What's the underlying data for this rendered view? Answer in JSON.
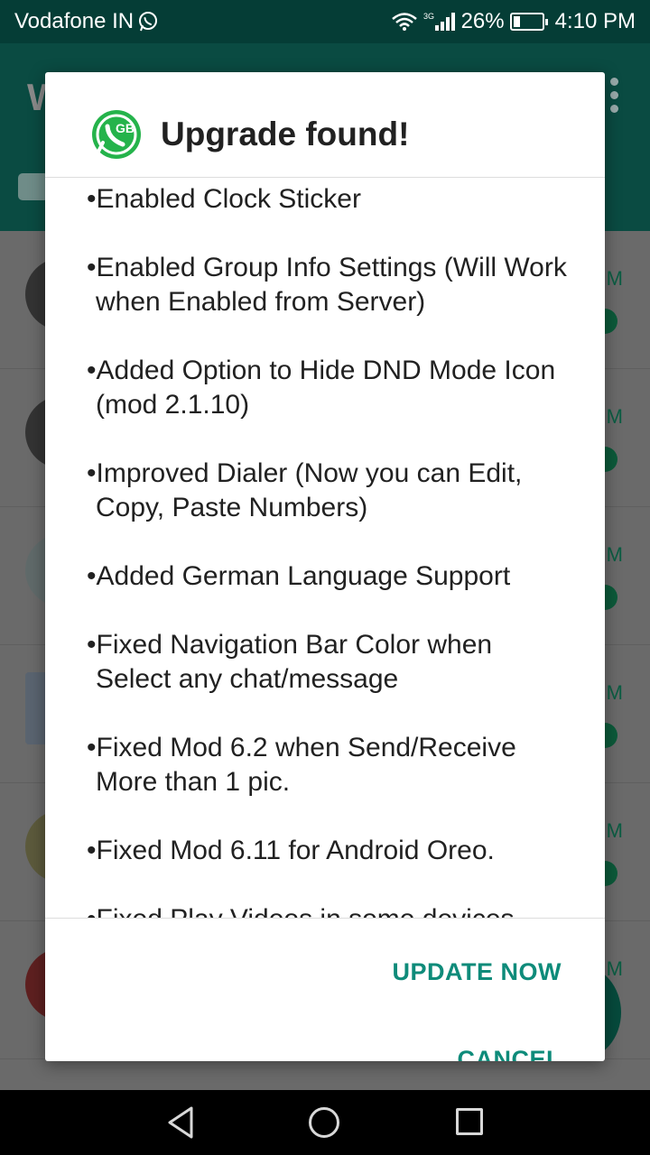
{
  "status_bar": {
    "carrier": "Vodafone IN",
    "network": "3G",
    "battery_percent": "26%",
    "battery_level": 0.26,
    "time": "4:10 PM"
  },
  "dialog": {
    "title": "Upgrade found!",
    "changelog": [
      "Enabled Clock Sticker",
      "Enabled Group Info Settings (Will Work when Enabled from Server)",
      "Added Option to Hide DND Mode Icon (mod 2.1.10)",
      "Improved Dialer (Now you can Edit, Copy, Paste Numbers)",
      "Added German Language Support",
      "Fixed Navigation Bar Color when Select any chat/message",
      "Fixed Mod 6.2 when Send/Receive More than 1 pic.",
      "Fixed Mod 6.11 for Android Oreo.",
      "Fixed Play Videos in some devices"
    ],
    "update_label": "UPDATE NOW",
    "cancel_label": "CANCEL"
  },
  "colors": {
    "accent": "#0e8b7a",
    "status_bar": "#053d36",
    "logo_green": "#25b34b"
  },
  "icons": [
    "whatsapp-icon",
    "wifi-icon",
    "signal-icon",
    "battery-icon",
    "gb-whatsapp-logo",
    "back-icon",
    "home-icon",
    "recents-icon"
  ]
}
